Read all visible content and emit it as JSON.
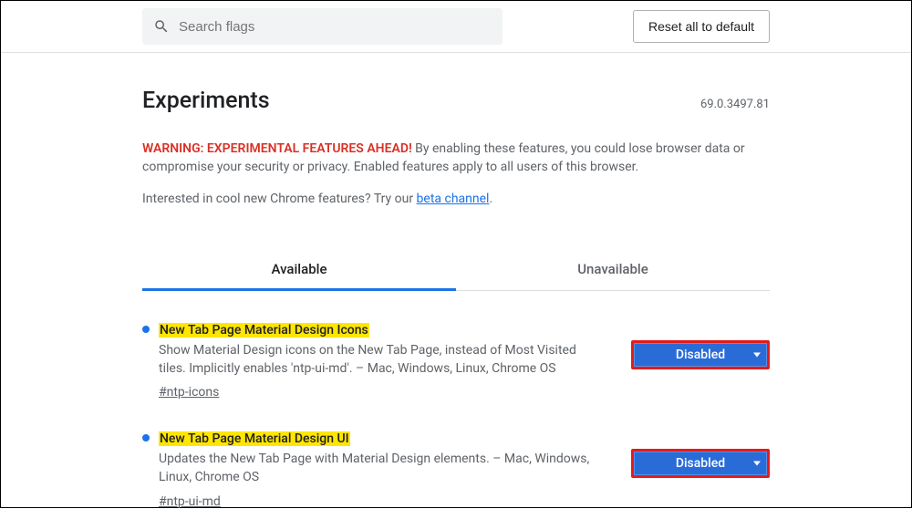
{
  "topbar": {
    "search_placeholder": "Search flags",
    "reset_label": "Reset all to default"
  },
  "header": {
    "title": "Experiments",
    "version": "69.0.3497.81"
  },
  "warning": {
    "label": "WARNING: EXPERIMENTAL FEATURES AHEAD!",
    "text": " By enabling these features, you could lose browser data or compromise your security or privacy. Enabled features apply to all users of this browser."
  },
  "interest": {
    "prefix": "Interested in cool new Chrome features? Try our ",
    "link_text": "beta channel",
    "suffix": "."
  },
  "tabs": {
    "available": "Available",
    "unavailable": "Unavailable"
  },
  "flags": [
    {
      "title": "New Tab Page Material Design Icons",
      "desc": "Show Material Design icons on the New Tab Page, instead of Most Visited tiles. Implicitly enables 'ntp-ui-md'. – Mac, Windows, Linux, Chrome OS",
      "hash": "#ntp-icons",
      "value": "Disabled"
    },
    {
      "title": "New Tab Page Material Design UI",
      "desc": "Updates the New Tab Page with Material Design elements. – Mac, Windows, Linux, Chrome OS",
      "hash": "#ntp-ui-md",
      "value": "Disabled"
    }
  ]
}
